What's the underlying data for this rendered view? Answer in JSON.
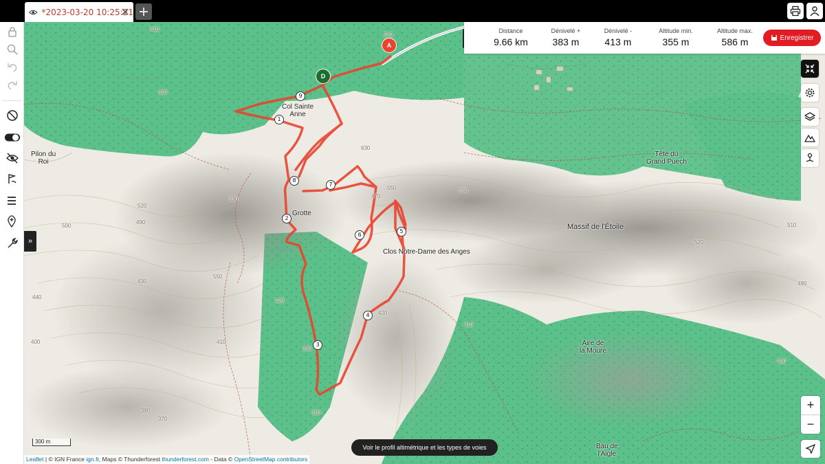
{
  "tab": {
    "title": "*2023-03-20 10:25:21"
  },
  "stats": [
    {
      "label": "Distance",
      "value": "9.66 km"
    },
    {
      "label": "Dénivelé +",
      "value": "383 m"
    },
    {
      "label": "Dénivelé -",
      "value": "413 m"
    },
    {
      "label": "Altitude min.",
      "value": "355 m"
    },
    {
      "label": "Altitude max.",
      "value": "586 m"
    }
  ],
  "save_label": "Enregistrer",
  "profile_label": "Voir le profil altimétrique et les types de voies",
  "scale_label": "300 m",
  "attribution": {
    "leaflet": "Leaflet",
    "ign_prefix": " | © IGN France ",
    "ign_link": "ign.fr",
    "maps_prefix": ", Maps © Thunderforest ",
    "thunder_link": "thunderforest.com",
    "data_prefix": " - Data © ",
    "osm_link": "OpenStreetMap contributors"
  },
  "places": {
    "col": "Col Sainte\nAnne",
    "pilon": "Pilon du\nRoi",
    "grotte": "Grotte",
    "clos": "Clos Notre-Dame des Anges",
    "massif": "Massif de l'Étoile",
    "tete": "Tête du\nGrand Puech",
    "aire": "Aire de\nla Moure",
    "bau": "Bau de\nl'Aigle"
  },
  "markers": {
    "start": "D",
    "end": "A"
  },
  "waypoints": [
    "1",
    "2",
    "3",
    "4",
    "5",
    "6",
    "7",
    "8",
    "9"
  ],
  "contour_labels": [
    "410",
    "510",
    "480",
    "630",
    "550",
    "520",
    "500",
    "490",
    "530",
    "550",
    "440",
    "430",
    "420",
    "410",
    "400",
    "390",
    "370",
    "350",
    "380",
    "420",
    "550",
    "520",
    "510",
    "490",
    "420",
    "410",
    "400",
    "470"
  ],
  "colors": {
    "route": "#e8442e",
    "forest": "#5cc08a",
    "save": "#e31b23",
    "tab_title": "#c0392b"
  }
}
